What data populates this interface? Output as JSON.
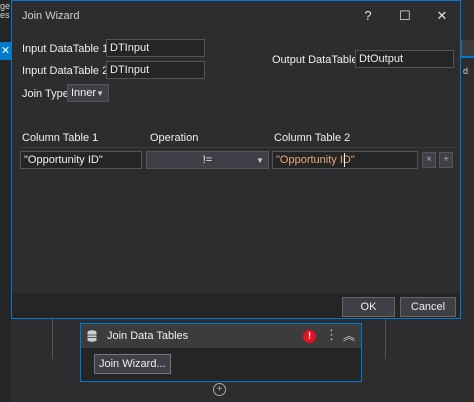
{
  "dialog": {
    "title": "Join Wizard",
    "help_glyph": "?",
    "maximize_glyph": "☐",
    "close_glyph": "✕",
    "input1_label": "Input DataTable 1",
    "input1_value": "DTInput",
    "input2_label": "Input DataTable 2",
    "input2_value": "DTInput",
    "output_label": "Output DataTable",
    "output_value": "DtOutput",
    "join_type_label": "Join Type",
    "join_type_value": "Inner",
    "columns": {
      "col1_header": "Column Table 1",
      "operation_header": "Operation",
      "col2_header": "Column Table 2"
    },
    "row": {
      "col1_value": "\"Opportunity ID\"",
      "operation_value": "!=",
      "col2_value": "\"Opportunity ID\""
    },
    "remove_row_glyph": "×",
    "add_row_glyph": "+",
    "ok_label": "OK",
    "cancel_label": "Cancel"
  },
  "background": {
    "left_text": "ge es",
    "close_tab_glyph": "✕",
    "right_text": "d",
    "activity_title": "Join Data Tables",
    "error_glyph": "!",
    "more_glyph": "⋮",
    "collapse_glyph": "︽",
    "wizard_button_label": "Join Wizard...",
    "add_glyph": "+"
  },
  "colors": {
    "accent": "#007acc",
    "dialog_bg": "#2d2d30",
    "field_bg": "#252526",
    "error": "#e81123"
  },
  "icons": {
    "activity_icon": "database-icon"
  }
}
